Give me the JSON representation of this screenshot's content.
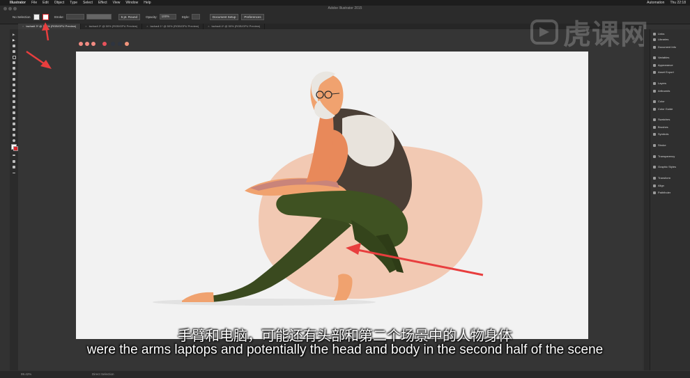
{
  "menubar": {
    "app_name": "Illustrator",
    "items": [
      "File",
      "Edit",
      "Object",
      "Type",
      "Select",
      "Effect",
      "View",
      "Window",
      "Help"
    ],
    "right_items": [
      "Automation",
      "Thu 22:18"
    ]
  },
  "window": {
    "title": "Adobe Illustrator 2015"
  },
  "control_bar": {
    "selection_label": "No Selection",
    "stroke_label": "Stroke:",
    "brush_label": "5 pt. Round",
    "opacity_label": "Opacity:",
    "opacity_value": "100%",
    "style_label": "Style:",
    "doc_setup_button": "Document Setup",
    "preferences_button": "Preferences"
  },
  "tabs": [
    {
      "label": "tachadi 3* @ 100% (RGB/GPU Preview)"
    },
    {
      "label": "tachadi 2* @ 50% (RGB/GPU Preview)"
    },
    {
      "label": "tachadi 1* @ 50% (RGB/GPU Preview)"
    },
    {
      "label": "tachadi 4* @ 50% (RGB/GPU Preview)"
    }
  ],
  "palette_colors": [
    "#f28b82",
    "#f28b82",
    "#f28b82",
    "#e8525b",
    "#2e3440",
    "#2e3440",
    "#f2957c"
  ],
  "right_panel": {
    "items": [
      {
        "label": "Links",
        "icon": "links-icon"
      },
      {
        "label": "Libraries",
        "icon": "libraries-icon"
      },
      {
        "label": "Document Info",
        "icon": "document-info-icon"
      },
      {
        "label": "Variables",
        "icon": "variables-icon"
      },
      {
        "label": "Appearance",
        "icon": "appearance-icon"
      },
      {
        "label": "Asset Export",
        "icon": "asset-export-icon"
      },
      {
        "label": "Layers",
        "icon": "layers-icon"
      },
      {
        "label": "Artboards",
        "icon": "artboards-icon"
      },
      {
        "label": "Color",
        "icon": "color-icon"
      },
      {
        "label": "Color Guide",
        "icon": "color-guide-icon"
      },
      {
        "label": "Swatches",
        "icon": "swatches-icon"
      },
      {
        "label": "Brushes",
        "icon": "brushes-icon"
      },
      {
        "label": "Symbols",
        "icon": "symbols-icon"
      },
      {
        "label": "Stroke",
        "icon": "stroke-icon"
      },
      {
        "label": "Transparency",
        "icon": "transparency-icon"
      },
      {
        "label": "Graphic Styles",
        "icon": "graphic-styles-icon"
      },
      {
        "label": "Transform",
        "icon": "transform-icon"
      },
      {
        "label": "Align",
        "icon": "align-icon"
      },
      {
        "label": "Pathfinder",
        "icon": "pathfinder-icon"
      }
    ]
  },
  "status_bar": {
    "zoom": "99.42%",
    "tool_name": "Direct Selection"
  },
  "watermark": {
    "text": "虎课网"
  },
  "subtitles": {
    "chinese": "手臂和电脑，可能还有头部和第二个场景中的人物身体",
    "english": "were the arms laptops and potentially the head and body in the second half of the scene"
  },
  "colors": {
    "accent_red": "#e83e3e",
    "artboard_bg": "#f2f2f2",
    "blob": "#f2c9b3",
    "skin": "#f0a26f",
    "pants": "#3a4a1f",
    "vest": "#4b3f36",
    "shirt": "#e8e3dc"
  }
}
